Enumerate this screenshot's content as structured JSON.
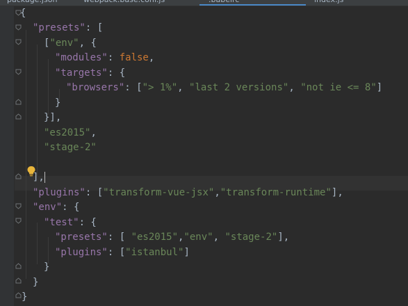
{
  "tabs": [
    {
      "label": "package.json"
    },
    {
      "label": "webpack.base.conf.js"
    },
    {
      "label": ".babelrc"
    },
    {
      "label": "index.js"
    }
  ],
  "editor": {
    "lines": [
      [
        "{"
      ],
      [
        "\"presets\"",
        ": ["
      ],
      [
        "[",
        "\"env\"",
        ", {"
      ],
      [
        "\"modules\"",
        ": ",
        "false",
        ","
      ],
      [
        "\"targets\"",
        ": {"
      ],
      [
        "\"browsers\"",
        ": [",
        "\"> 1%\"",
        ", ",
        "\"last 2 versions\"",
        ", ",
        "\"not ie <= 8\"",
        "]"
      ],
      [
        "}"
      ],
      [
        "}],"
      ],
      [
        "\"es2015\"",
        ","
      ],
      [
        "\"stage-2\""
      ],
      [
        ""
      ],
      [
        "],"
      ],
      [
        "\"plugins\"",
        ": [",
        "\"transform-vue-jsx\"",
        ",",
        "\"transform-runtime\"",
        "],"
      ],
      [
        "\"env\"",
        ": {"
      ],
      [
        "\"test\"",
        ": {"
      ],
      [
        "\"presets\"",
        ": [ ",
        "\"es2015\"",
        ",",
        "\"env\"",
        ", ",
        "\"stage-2\"",
        "],"
      ],
      [
        "\"plugins\"",
        ": [",
        "\"istanbul\"",
        "]"
      ],
      [
        "}"
      ],
      [
        "}"
      ],
      [
        "}"
      ]
    ]
  }
}
